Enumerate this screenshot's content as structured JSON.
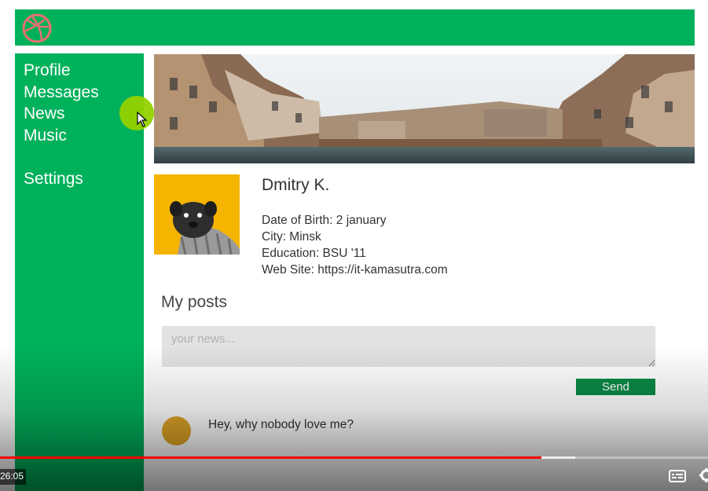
{
  "header": {
    "logo_icon": "dribbble-ball-icon"
  },
  "sidebar": {
    "items": [
      {
        "label": "Profile"
      },
      {
        "label": "Messages"
      },
      {
        "label": "News"
      },
      {
        "label": "Music"
      },
      {
        "label": "Settings"
      }
    ]
  },
  "profile": {
    "banner": "city-canal-banner-image",
    "avatar": "pug-avatar-image",
    "name": "Dmitry K.",
    "info": [
      "Date of Birth: 2 january",
      "City: Minsk",
      "Education: BSU '11",
      "Web Site: https://it-kamasutra.com"
    ]
  },
  "posts": {
    "title": "My posts",
    "input_placeholder": "your news...",
    "send_label": "Send",
    "items": [
      {
        "text": "Hey, why nobody love me?"
      }
    ]
  },
  "video": {
    "time": "26:05",
    "played_fraction": 0.765,
    "buffered_fraction": 0.812
  },
  "colors": {
    "brand_green": "#00b15b",
    "send_button": "#0a8a46",
    "avatar_yellow": "#f4b400",
    "progress_red": "#ff0000"
  }
}
